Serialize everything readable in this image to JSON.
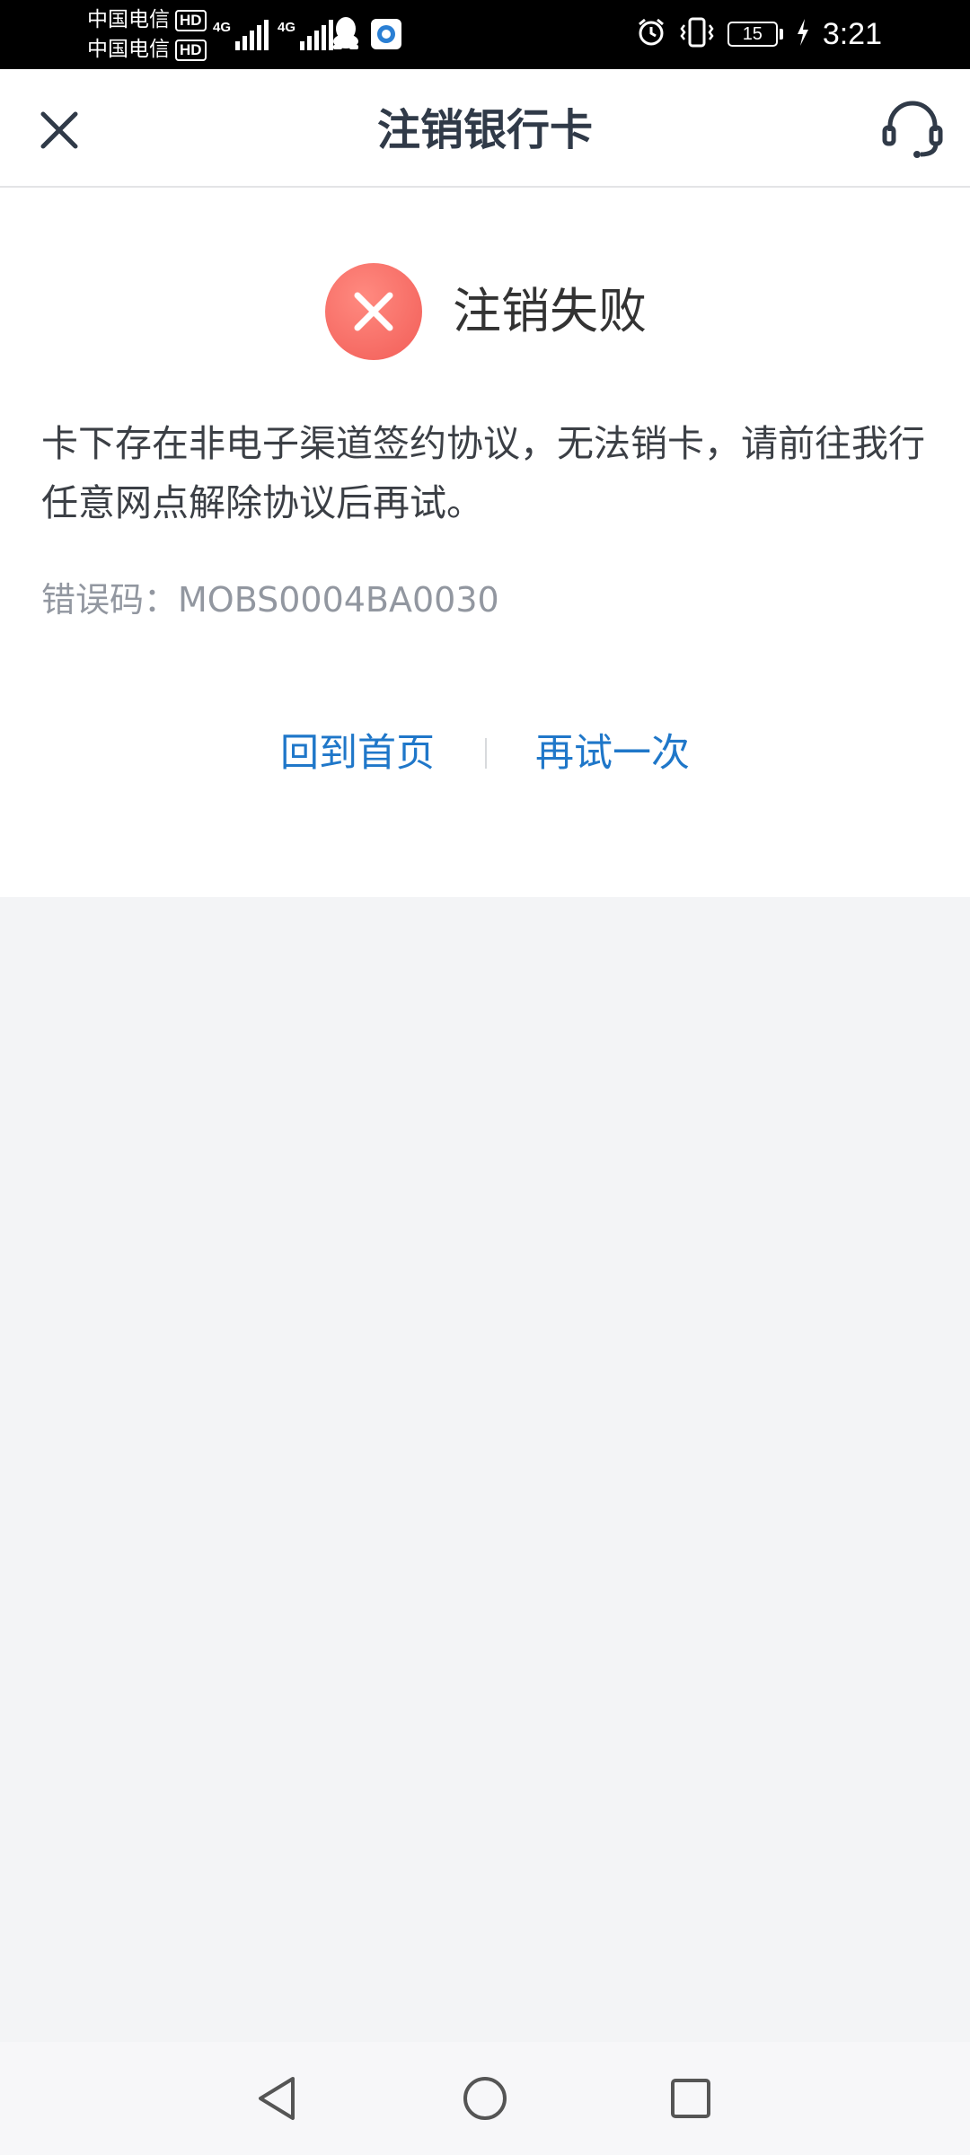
{
  "status_bar": {
    "carrier1": "中国电信",
    "carrier2": "中国电信",
    "hd_label": "HD",
    "network_label1": "4G",
    "network_label2": "4G",
    "battery_level": "15",
    "time": "3:21"
  },
  "header": {
    "title": "注销银行卡"
  },
  "result": {
    "title": "注销失败",
    "message": "卡下存在非电子渠道签约协议，无法销卡，请前往我行任意网点解除协议后再试。",
    "error_code": "错误码：MOBS0004BA0030"
  },
  "actions": {
    "home_label": "回到首页",
    "retry_label": "再试一次"
  },
  "colors": {
    "accent": "#1f77c9",
    "error": "#f25d57",
    "background": "#f3f4f6"
  }
}
